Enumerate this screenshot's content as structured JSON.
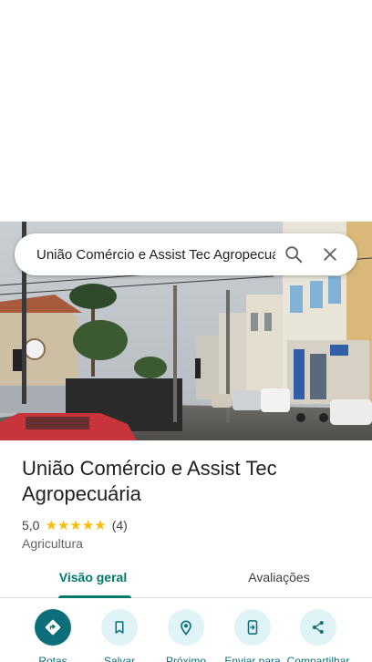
{
  "search": {
    "query": "União Comércio e Assist Tec Agropecuária",
    "search_icon": "search-icon",
    "close_icon": "close-icon"
  },
  "place": {
    "name": "União Comércio e Assist Tec Agropecuária",
    "rating": "5,0",
    "stars": 5,
    "review_count": "(4)",
    "category": "Agricultura"
  },
  "tabs": [
    {
      "label": "Visão geral",
      "active": true
    },
    {
      "label": "Avaliações",
      "active": false
    }
  ],
  "actions": [
    {
      "label": "Rotas",
      "icon": "directions-icon"
    },
    {
      "label": "Salvar",
      "icon": "bookmark-icon"
    },
    {
      "label": "Próximo",
      "icon": "nearby-icon"
    },
    {
      "label": "Enviar para",
      "icon": "send-to-phone-icon"
    },
    {
      "label": "Compartilhar",
      "icon": "share-icon"
    }
  ],
  "colors": {
    "accent": "#00796b",
    "action_primary": "#0b6e79",
    "action_bg": "#e0f4f7",
    "star": "#fbbc04"
  }
}
